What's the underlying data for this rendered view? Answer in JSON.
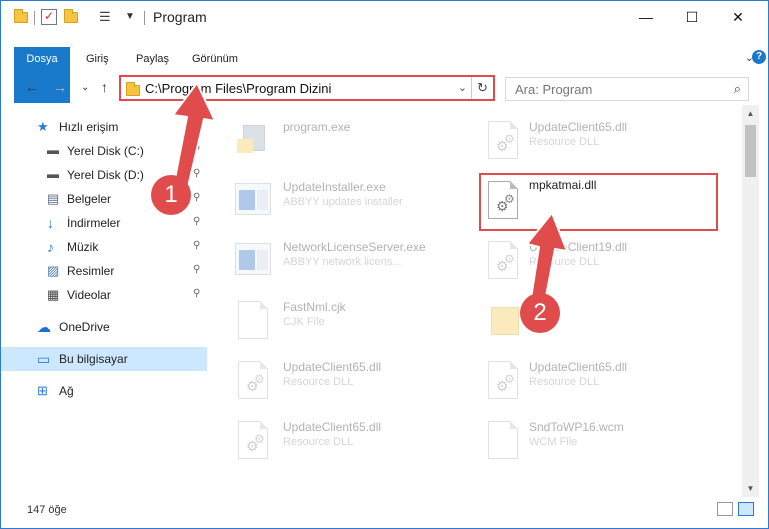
{
  "window": {
    "title": "Program",
    "controls": {
      "minimize": "—",
      "maximize": "☐",
      "close": "✕"
    }
  },
  "ribbon": {
    "tabs": [
      "Dosya",
      "Giriş",
      "Paylaş",
      "Görünüm"
    ],
    "expand": "⌄",
    "help": "?"
  },
  "nav": {
    "back": "←",
    "forward": "→",
    "recent": "⌄",
    "up": "↑",
    "address": "C:\\Program Files\\Program Dizini",
    "address_dropdown": "⌄",
    "refresh": "↻",
    "search_placeholder": "Ara: Program",
    "search_icon": "⌕"
  },
  "sidebar": {
    "items": [
      {
        "label": "Hızlı erişim",
        "icon": "star-icon",
        "glyph": "★",
        "color": "#2b79d8",
        "pinned": false
      },
      {
        "label": "Yerel Disk (C:)",
        "icon": "drive-icon",
        "glyph": "▬",
        "color": "#555555",
        "pinned": true
      },
      {
        "label": "Yerel Disk (D:)",
        "icon": "drive-icon",
        "glyph": "▬",
        "color": "#555555",
        "pinned": true
      },
      {
        "label": "Belgeler",
        "icon": "documents-icon",
        "glyph": "▤",
        "color": "#5a6e8a",
        "pinned": true
      },
      {
        "label": "İndirmeler",
        "icon": "download-icon",
        "glyph": "↓",
        "color": "#2b79d8",
        "pinned": true
      },
      {
        "label": "Müzik",
        "icon": "music-icon",
        "glyph": "♪",
        "color": "#2b79d8",
        "pinned": true
      },
      {
        "label": "Resimler",
        "icon": "pictures-icon",
        "glyph": "▨",
        "color": "#4a7bb7",
        "pinned": true
      },
      {
        "label": "Videolar",
        "icon": "video-icon",
        "glyph": "▦",
        "color": "#444444",
        "pinned": true
      },
      {
        "label": "OneDrive",
        "icon": "cloud-icon",
        "glyph": "☁",
        "color": "#1e6fd0",
        "pinned": false
      },
      {
        "label": "Bu bilgisayar",
        "icon": "computer-icon",
        "glyph": "▭",
        "color": "#2b79d8",
        "pinned": false
      },
      {
        "label": "Ağ",
        "icon": "network-icon",
        "glyph": "⊞",
        "color": "#2b79d8",
        "pinned": false
      }
    ],
    "pin_glyph": "📌"
  },
  "files": [
    {
      "name": "program.exe",
      "desc": "",
      "icon": "exe-icon"
    },
    {
      "name": "UpdateClient65.dll",
      "desc": "Resource DLL",
      "icon": "dll-icon"
    },
    {
      "name": "UpdateInstaller.exe",
      "desc": "ABBYY updates installer",
      "icon": "app-icon"
    },
    {
      "name": "mpkatmai.dll",
      "desc": "",
      "icon": "dll-icon"
    },
    {
      "name": "NetworkLicenseServer.exe",
      "desc": "ABBYY network licens...",
      "icon": "app-icon"
    },
    {
      "name": "UpdateClient19.dll",
      "desc": "Resource DLL",
      "icon": "dll-icon"
    },
    {
      "name": "FastNml.cjk",
      "desc": "CJK File",
      "icon": "file-icon"
    },
    {
      "name": "",
      "desc": "",
      "icon": "folder-icon"
    },
    {
      "name": "UpdateClient65.dll",
      "desc": "Resource DLL",
      "icon": "dll-icon"
    },
    {
      "name": "UpdateClient65.dll",
      "desc": "Resource DLL",
      "icon": "dll-icon"
    },
    {
      "name": "UpdateClient65.dll",
      "desc": "Resource DLL",
      "icon": "dll-icon"
    },
    {
      "name": "SndToWP16.wcm",
      "desc": "WCM File",
      "icon": "file-icon"
    }
  ],
  "status": {
    "count": "147 öğe"
  },
  "callouts": [
    "1",
    "2"
  ],
  "colors": {
    "accent": "#1979ca",
    "highlight": "#e04b4b",
    "selection": "#cce8ff"
  }
}
